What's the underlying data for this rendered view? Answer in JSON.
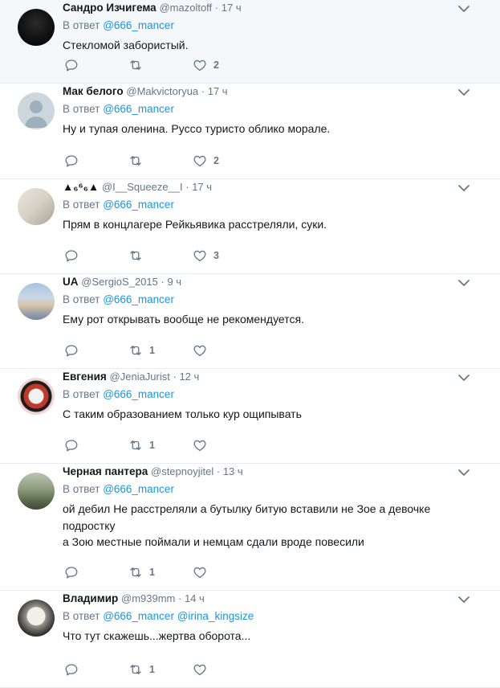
{
  "feed": {
    "tweets": [
      {
        "name": "Сандро Изчигема",
        "handle": "@mazoltoff",
        "time": "17 ч",
        "reply_prefix": "В ответ",
        "mentions": [
          "@666_mancer"
        ],
        "lines": [
          "Стекломой забористый."
        ],
        "retweets": "",
        "likes": "2"
      },
      {
        "name": "Мак белого",
        "handle": "@Makvictoryua",
        "time": "17 ч",
        "reply_prefix": "В ответ",
        "mentions": [
          "@666_mancer"
        ],
        "lines": [
          "Ну и тупая оленина. Руссо туристо облико морале."
        ],
        "retweets": "",
        "likes": "2"
      },
      {
        "name": "▲₆⁶₆▲",
        "handle": "@I__Squeeze__I",
        "time": "17 ч",
        "reply_prefix": "В ответ",
        "mentions": [
          "@666_mancer"
        ],
        "lines": [
          "Прям в концлагере Рейкьявика расстреляли, суки."
        ],
        "retweets": "",
        "likes": "3"
      },
      {
        "name": "UA",
        "handle": "@SergioS_2015",
        "time": "9 ч",
        "reply_prefix": "В ответ",
        "mentions": [
          "@666_mancer"
        ],
        "lines": [
          "Ему рот открывать вообще не рекомендуется."
        ],
        "retweets": "1",
        "likes": ""
      },
      {
        "name": "Евгения",
        "handle": "@JeniaJurist",
        "time": "12 ч",
        "reply_prefix": "В ответ",
        "mentions": [
          "@666_mancer"
        ],
        "lines": [
          "С таким образованием только кур ощипывать"
        ],
        "retweets": "1",
        "likes": ""
      },
      {
        "name": "Черная пантера",
        "handle": "@stepnoyjitel",
        "time": "13 ч",
        "reply_prefix": "В ответ",
        "mentions": [
          "@666_mancer"
        ],
        "lines": [
          "ой дебил Не расстреляли а бутылку битую вставили не Зое а девочке",
          "подростку",
          "а Зою местные поймали и немцам сдали вроде повесили"
        ],
        "retweets": "1",
        "likes": ""
      },
      {
        "name": "Владимир",
        "handle": "@m939mm",
        "time": "14 ч",
        "reply_prefix": "В ответ",
        "mentions": [
          "@666_mancer",
          "@irina_kingsize"
        ],
        "lines": [
          "Что тут скажешь...жертва оборота..."
        ],
        "retweets": "1",
        "likes": ""
      }
    ]
  },
  "colors": {
    "link": "#1b95e0",
    "muted": "#657786",
    "text": "#14171a",
    "highlight_bg": "#f5f8fa",
    "divider": "#e6ecf0"
  },
  "icons": {
    "reply": "reply-icon",
    "retweet": "retweet-icon",
    "like": "heart-icon",
    "menu": "chevron-down-icon"
  }
}
